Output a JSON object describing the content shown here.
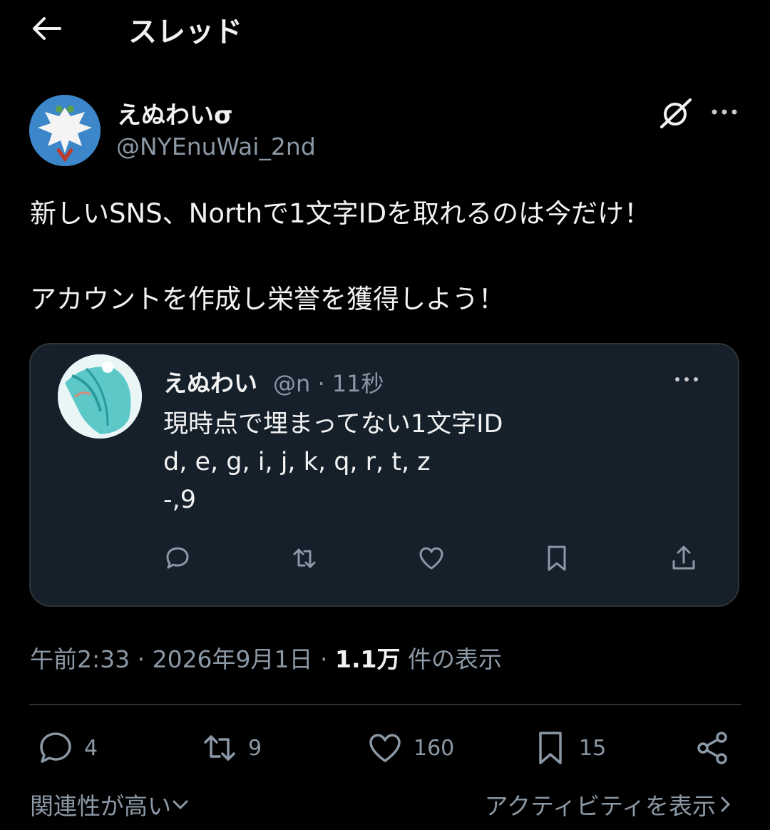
{
  "header": {
    "title": "スレッド",
    "back_icon": "arrow-left-icon"
  },
  "post": {
    "author": {
      "display_name": "えぬわいσ",
      "handle": "@NYEnuWai_2nd"
    },
    "text_line1": "新しいSNS、Northで1文字IDを取れるのは今だけ！",
    "text_line2": "アカウントを作成し栄誉を獲得しよう！",
    "quote": {
      "display_name": "えぬわい",
      "meta": "@n · 11秒",
      "lines": [
        "現時点で埋まってない1文字ID",
        "d, e, g, i, j, k, q, r, t, z",
        "-,9"
      ]
    },
    "timestamp": {
      "time_date": "午前2:33 · 2026年9月1日 · ",
      "views_count": "1.1万",
      "views_label": " 件の表示"
    },
    "stats": {
      "replies": "4",
      "reposts": "9",
      "likes": "160",
      "bookmarks": "15"
    }
  },
  "footer": {
    "sort_label": "関連性が高い",
    "activity_label": "アクティビティを表示"
  },
  "colors": {
    "background": "#000000",
    "text": "#e7e9ea",
    "muted": "#8b98a5",
    "quote_bg": "#15202b",
    "border": "#2f3336"
  }
}
